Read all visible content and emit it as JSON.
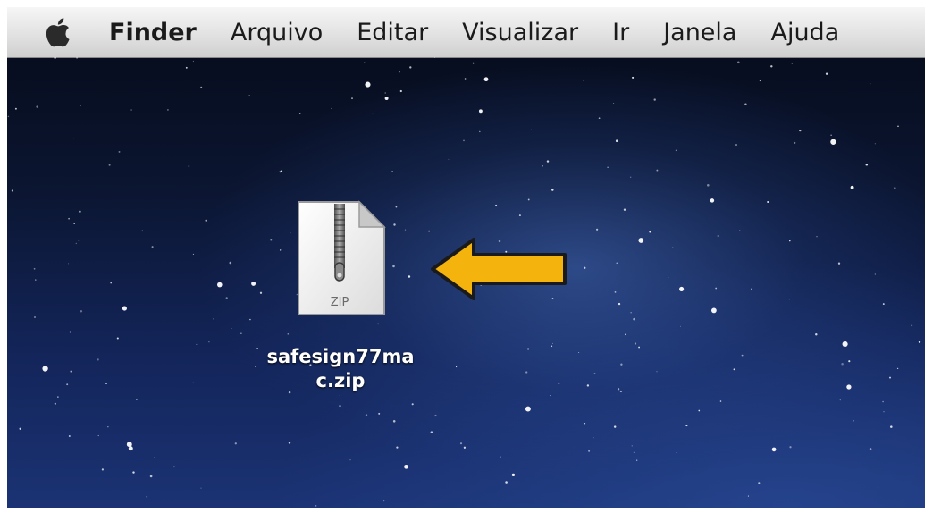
{
  "menubar": {
    "apple_icon": "apple-logo-icon",
    "items": [
      {
        "label": "Finder"
      },
      {
        "label": "Arquivo"
      },
      {
        "label": "Editar"
      },
      {
        "label": "Visualizar"
      },
      {
        "label": "Ir"
      },
      {
        "label": "Janela"
      },
      {
        "label": "Ajuda"
      }
    ]
  },
  "desktop": {
    "file": {
      "name_line1": "safesign77ma",
      "name_line2": "c.zip",
      "badge": "ZIP",
      "icon": "zip-file-icon"
    },
    "annotation": {
      "icon": "arrow-left-icon",
      "color": "#f5b40d"
    }
  },
  "colors": {
    "desktop_dark": "#0b1530",
    "desktop_light": "#1b3374",
    "menubar": "#e2e2e2"
  }
}
